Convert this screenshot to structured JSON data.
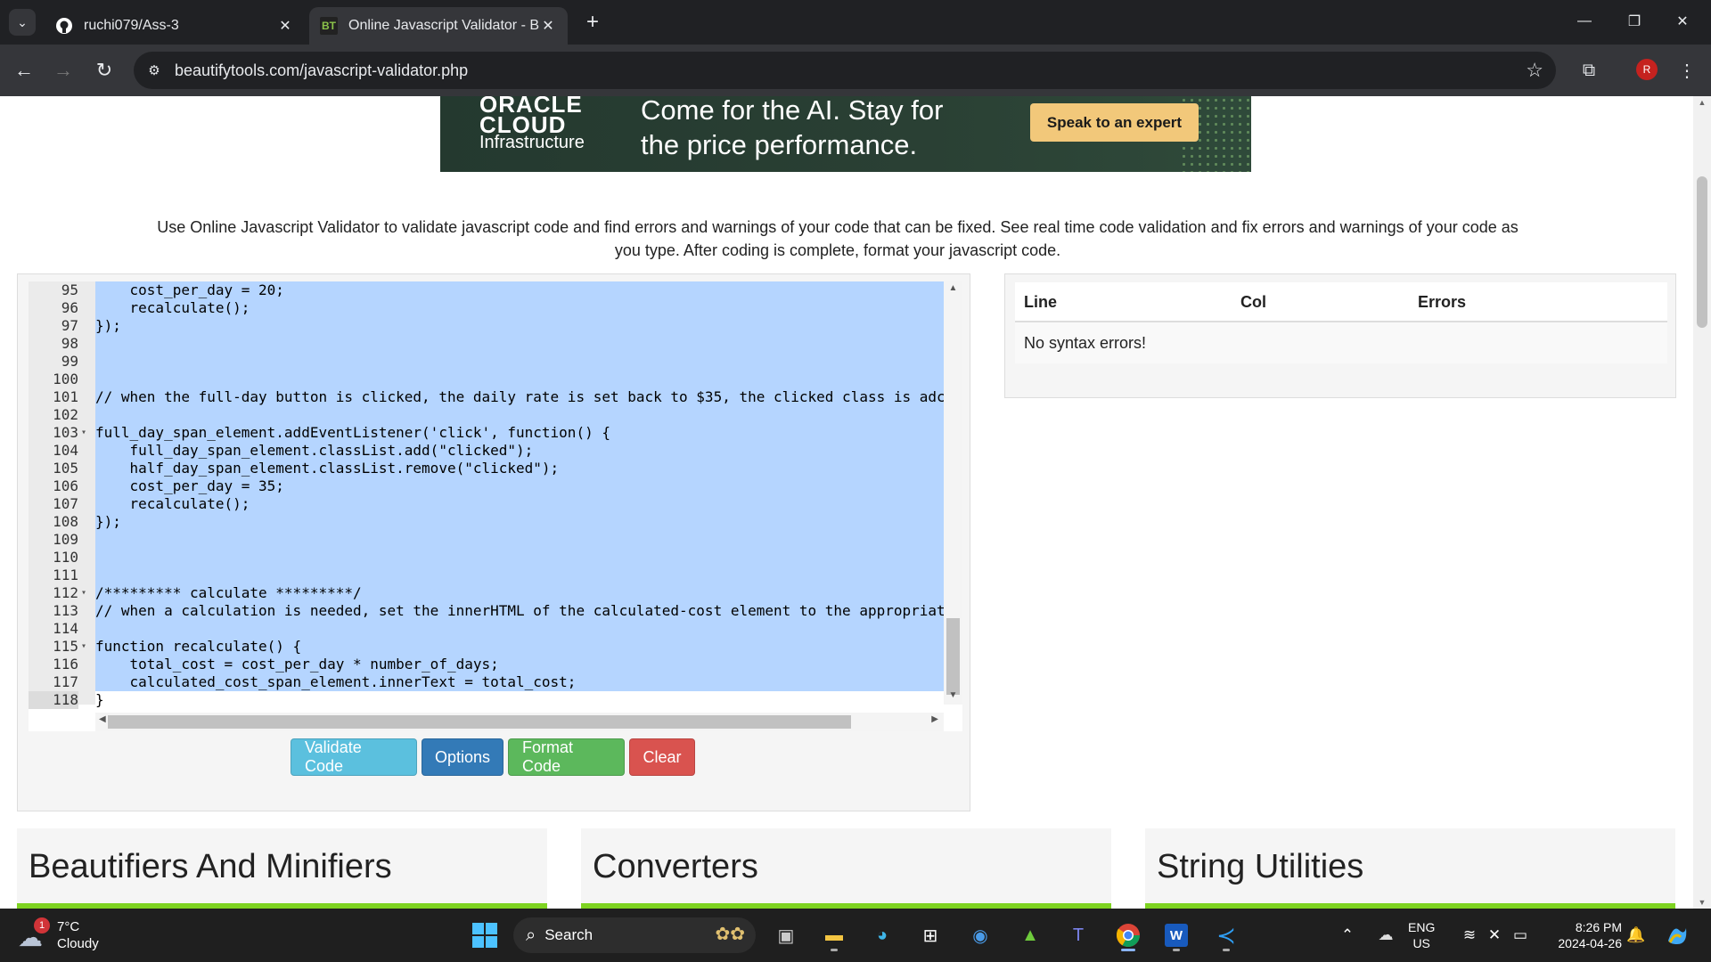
{
  "browser": {
    "tabs": [
      {
        "title": "ruchi079/Ass-3",
        "icon": "github-icon"
      },
      {
        "title": "Online Javascript Validator - Be",
        "icon": "beautifytools-icon",
        "favicon_text": "BT"
      }
    ],
    "url": "beautifytools.com/javascript-validator.php",
    "profile_initial": "R"
  },
  "ad": {
    "brand_line1": "ORACLE",
    "brand_line2": "CLOUD",
    "brand_line3": "Infrastructure",
    "tagline": "Come for the AI. Stay for the price performance.",
    "cta": "Speak to an expert",
    "bg_color": "#24392f",
    "cta_color": "#f2c87a"
  },
  "description": "Use Online Javascript Validator to validate javascript code and find errors and warnings of your code that can be fixed. See real time code validation and fix errors and warnings of your code as you type. After coding is complete, format your javascript code.",
  "editor": {
    "selection_color": "#b5d5ff",
    "active_line": "118",
    "lines": [
      {
        "n": "95",
        "fold": "",
        "text": "    cost_per_day = 20;"
      },
      {
        "n": "96",
        "fold": "",
        "text": "    recalculate();"
      },
      {
        "n": "97",
        "fold": "",
        "text": "});"
      },
      {
        "n": "98",
        "fold": "",
        "text": ""
      },
      {
        "n": "99",
        "fold": "",
        "text": ""
      },
      {
        "n": "100",
        "fold": "",
        "text": ""
      },
      {
        "n": "101",
        "fold": "",
        "text": "// when the full-day button is clicked, the daily rate is set back to $35, the clicked class is adc"
      },
      {
        "n": "102",
        "fold": "",
        "text": ""
      },
      {
        "n": "103",
        "fold": "▾",
        "text": "full_day_span_element.addEventListener('click', function() {"
      },
      {
        "n": "104",
        "fold": "",
        "text": "    full_day_span_element.classList.add(\"clicked\");"
      },
      {
        "n": "105",
        "fold": "",
        "text": "    half_day_span_element.classList.remove(\"clicked\");"
      },
      {
        "n": "106",
        "fold": "",
        "text": "    cost_per_day = 35;"
      },
      {
        "n": "107",
        "fold": "",
        "text": "    recalculate();"
      },
      {
        "n": "108",
        "fold": "",
        "text": "});"
      },
      {
        "n": "109",
        "fold": "",
        "text": ""
      },
      {
        "n": "110",
        "fold": "",
        "text": ""
      },
      {
        "n": "111",
        "fold": "",
        "text": ""
      },
      {
        "n": "112",
        "fold": "▾",
        "text": "/********* calculate *********/"
      },
      {
        "n": "113",
        "fold": "",
        "text": "// when a calculation is needed, set the innerHTML of the calculated-cost element to the appropriat"
      },
      {
        "n": "114",
        "fold": "",
        "text": ""
      },
      {
        "n": "115",
        "fold": "▾",
        "text": "function recalculate() {"
      },
      {
        "n": "116",
        "fold": "",
        "text": "    total_cost = cost_per_day * number_of_days;"
      },
      {
        "n": "117",
        "fold": "",
        "text": "    calculated_cost_span_element.innerText = total_cost;"
      },
      {
        "n": "118",
        "fold": "",
        "text": "}"
      }
    ]
  },
  "buttons": {
    "validate": "Validate Code",
    "options": "Options",
    "format": "Format Code",
    "clear": "Clear"
  },
  "results": {
    "headers": [
      "Line",
      "Col",
      "Errors"
    ],
    "message": "No syntax errors!"
  },
  "categories": [
    "Beautifiers And Minifiers",
    "Converters",
    "String Utilities"
  ],
  "accent_color": "#7ed321",
  "taskbar": {
    "weather_temp": "7°C",
    "weather_desc": "Cloudy",
    "weather_badge": "1",
    "search_placeholder": "Search",
    "lang_line1": "ENG",
    "lang_line2": "US",
    "time": "8:26 PM",
    "date": "2024-04-26"
  }
}
